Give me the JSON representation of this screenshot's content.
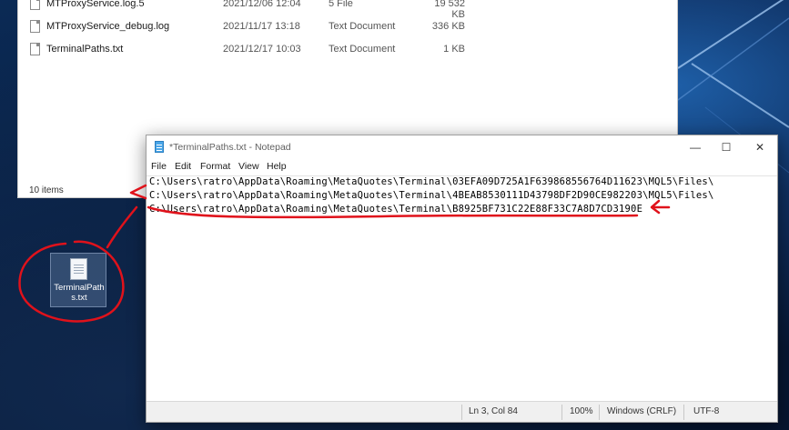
{
  "explorer": {
    "files": [
      {
        "name": "MTProxyService.log.5",
        "date": "2021/12/06 12:04",
        "type": "5 File",
        "size": "19 532 KB"
      },
      {
        "name": "MTProxyService_debug.log",
        "date": "2021/11/17 13:18",
        "type": "Text Document",
        "size": "336 KB"
      },
      {
        "name": "TerminalPaths.txt",
        "date": "2021/12/17 10:03",
        "type": "Text Document",
        "size": "1 KB"
      }
    ],
    "status_count": "10 items"
  },
  "desktop_icon": {
    "label": "TerminalPaths.txt"
  },
  "notepad": {
    "title": "*TerminalPaths.txt - Notepad",
    "controls": {
      "minimize": "—",
      "maximize": "☐",
      "close": "✕"
    },
    "menu": [
      "File",
      "Edit",
      "Format",
      "View",
      "Help"
    ],
    "lines": [
      "C:\\Users\\ratro\\AppData\\Roaming\\MetaQuotes\\Terminal\\03EFA09D725A1F639868556764D11623\\MQL5\\Files\\",
      "C:\\Users\\ratro\\AppData\\Roaming\\MetaQuotes\\Terminal\\4BEAB8530111D43798DF2D90CE982203\\MQL5\\Files\\",
      "C:\\Users\\ratro\\AppData\\Roaming\\MetaQuotes\\Terminal\\B8925BF731C22E88F33C7A8D7CD3190E"
    ],
    "status": {
      "position": "Ln 3, Col 84",
      "zoom": "100%",
      "line_ending": "Windows (CRLF)",
      "encoding": "UTF-8"
    }
  },
  "colors": {
    "annotation": "#e0121b",
    "desktop": "#0c1f3d"
  }
}
